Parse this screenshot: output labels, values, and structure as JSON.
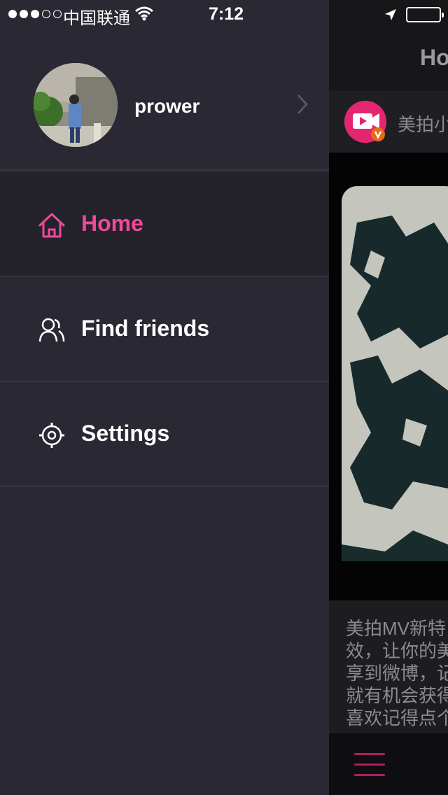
{
  "status_bar": {
    "carrier": "中国联通",
    "time": "7:12"
  },
  "profile": {
    "username": "prower"
  },
  "menu": {
    "items": [
      {
        "label": "Home",
        "icon": "home-icon",
        "active": true
      },
      {
        "label": "Find friends",
        "icon": "friends-icon",
        "active": false
      },
      {
        "label": "Settings",
        "icon": "gear-icon",
        "active": false
      }
    ]
  },
  "content": {
    "title": "Ho",
    "channel_name": "美拍小",
    "description": "美拍MV新特\n效，让你的美\n享到微博，记\n就有机会获得\n喜欢记得点个"
  },
  "colors": {
    "accent": "#f0489a",
    "menu_bg": "#2a2933",
    "active_bg": "#24232b"
  }
}
